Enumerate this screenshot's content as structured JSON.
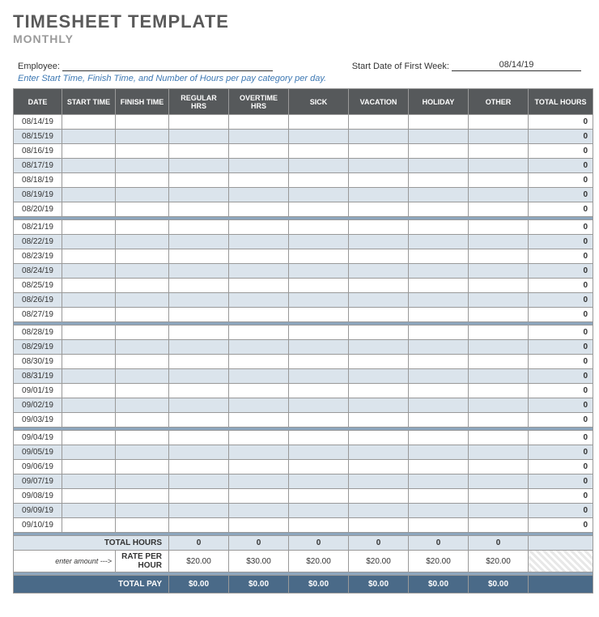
{
  "title": "TIMESHEET TEMPLATE",
  "subtitle": "MONTHLY",
  "employee_label": "Employee:",
  "employee_value": "",
  "startdate_label": "Start Date of First Week:",
  "startdate_value": "08/14/19",
  "instructions": "Enter Start Time, Finish Time, and Number of Hours per pay category per day.",
  "headers": [
    "DATE",
    "START TIME",
    "FINISH TIME",
    "REGULAR HRS",
    "OVERTIME HRS",
    "SICK",
    "VACATION",
    "HOLIDAY",
    "OTHER",
    "TOTAL HOURS"
  ],
  "weeks": [
    [
      "08/14/19",
      "08/15/19",
      "08/16/19",
      "08/17/19",
      "08/18/19",
      "08/19/19",
      "08/20/19"
    ],
    [
      "08/21/19",
      "08/22/19",
      "08/23/19",
      "08/24/19",
      "08/25/19",
      "08/26/19",
      "08/27/19"
    ],
    [
      "08/28/19",
      "08/29/19",
      "08/30/19",
      "08/31/19",
      "09/01/19",
      "09/02/19",
      "09/03/19"
    ],
    [
      "09/04/19",
      "09/05/19",
      "09/06/19",
      "09/07/19",
      "09/08/19",
      "09/09/19",
      "09/10/19"
    ]
  ],
  "row_total": "0",
  "summary": {
    "totalhours_label": "TOTAL HOURS",
    "totalhours": [
      "0",
      "0",
      "0",
      "0",
      "0",
      "0"
    ],
    "rate_hint": "enter amount --->",
    "rate_label": "RATE PER HOUR",
    "rates": [
      "$20.00",
      "$30.00",
      "$20.00",
      "$20.00",
      "$20.00",
      "$20.00"
    ],
    "totalpay_label": "TOTAL PAY",
    "totalpay": [
      "$0.00",
      "$0.00",
      "$0.00",
      "$0.00",
      "$0.00",
      "$0.00"
    ]
  }
}
